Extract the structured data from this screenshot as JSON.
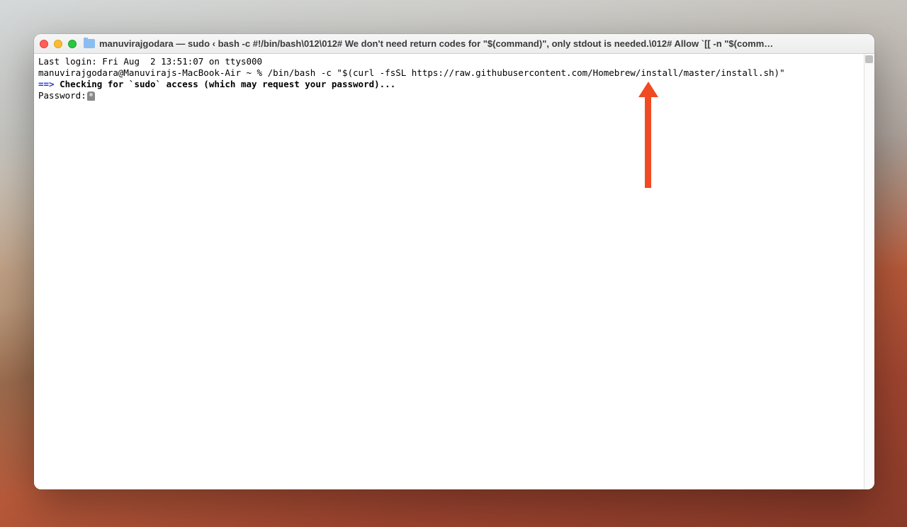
{
  "window": {
    "title": "manuvirajgodara — sudo ‹ bash -c #!/bin/bash\\012\\012# We don't need return codes for \"$(command)\", only stdout is needed.\\012# Allow `[[ -n \"$(comm…"
  },
  "terminal": {
    "last_login": "Last login: Fri Aug  2 13:51:07 on ttys000",
    "prompt_line": "manuvirajgodara@Manuvirajs-MacBook-Air ~ % /bin/bash -c \"$(curl -fsSL https://raw.githubusercontent.com/Homebrew/install/master/install.sh)\"",
    "arrow": "==>",
    "status_line": " Checking for `sudo` access (which may request your password)...",
    "password_label": "Password:"
  },
  "colors": {
    "arrow_prefix": "#2136d6",
    "annotation": "#f04a23"
  }
}
